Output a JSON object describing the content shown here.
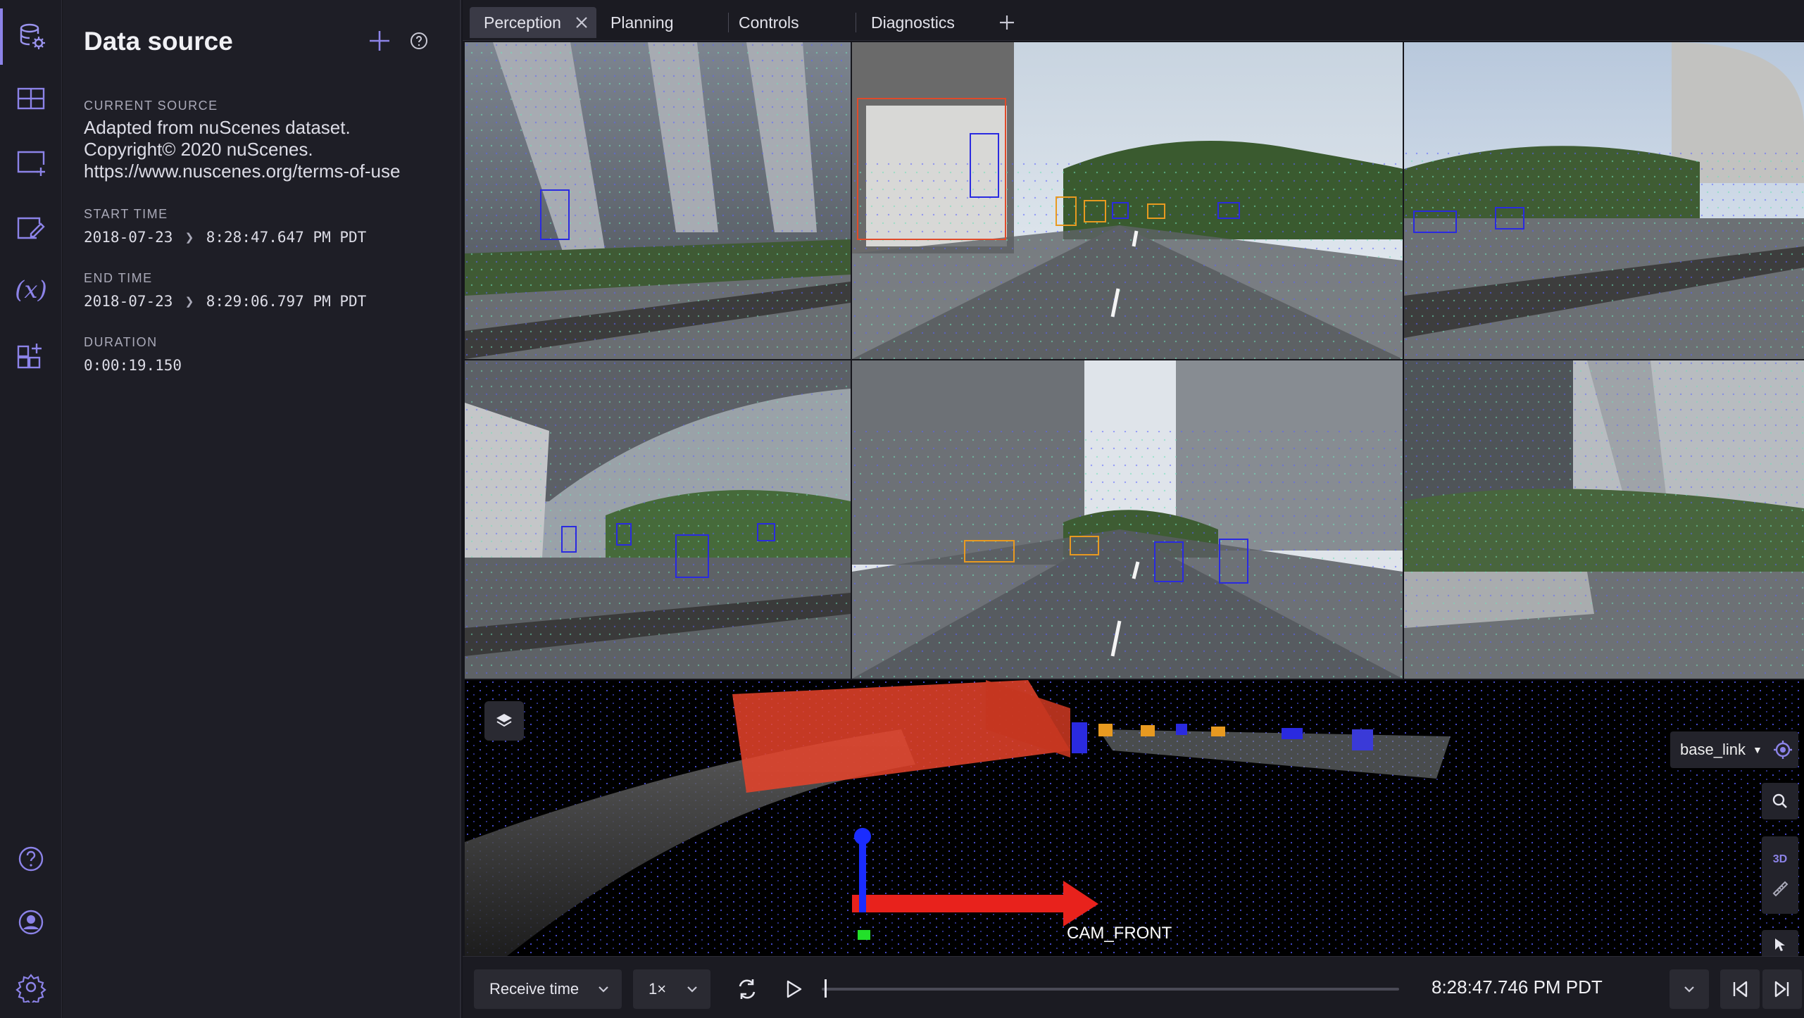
{
  "sidebar": {
    "icons": [
      "data-source-icon",
      "layout-grid-icon",
      "add-panel-icon",
      "edit-note-icon",
      "variables-icon",
      "extensions-icon",
      "help-icon",
      "account-icon",
      "settings-icon"
    ],
    "variables_glyph": "(x)"
  },
  "panel": {
    "title": "Data source",
    "current_source_label": "CURRENT SOURCE",
    "current_source_lines": [
      "Adapted from nuScenes dataset.",
      "Copyright© 2020 nuScenes.",
      "https://www.nuscenes.org/terms-of-use"
    ],
    "start_time_label": "START TIME",
    "start_date": "2018-07-23",
    "start_time": "8:28:47.647 PM PDT",
    "end_time_label": "END TIME",
    "end_date": "2018-07-23",
    "end_time": "8:29:06.797 PM PDT",
    "duration_label": "DURATION",
    "duration": "0:00:19.150"
  },
  "tabs": [
    {
      "label": "Perception",
      "active": true
    },
    {
      "label": "Planning",
      "active": false
    },
    {
      "label": "Controls",
      "active": false
    },
    {
      "label": "Diagnostics",
      "active": false
    }
  ],
  "view3d": {
    "frame": "base_link",
    "camera_label": "CAM_FRONT",
    "mode_3d": "3D"
  },
  "playback": {
    "time_source": "Receive time",
    "speed": "1×",
    "current_time": "8:28:47.746 PM PDT",
    "progress": 0.005
  },
  "colors": {
    "accent": "#8c83e8",
    "lidar_blue": "#5a62ff",
    "lidar_green": "#6fe0b8",
    "bbox_blue": "#2a2ae0",
    "bbox_orange": "#e89a20",
    "bbox_red": "#e04a2a",
    "axis_red": "#e8221c",
    "axis_blue": "#1a2cff",
    "axis_green": "#22e02a"
  }
}
